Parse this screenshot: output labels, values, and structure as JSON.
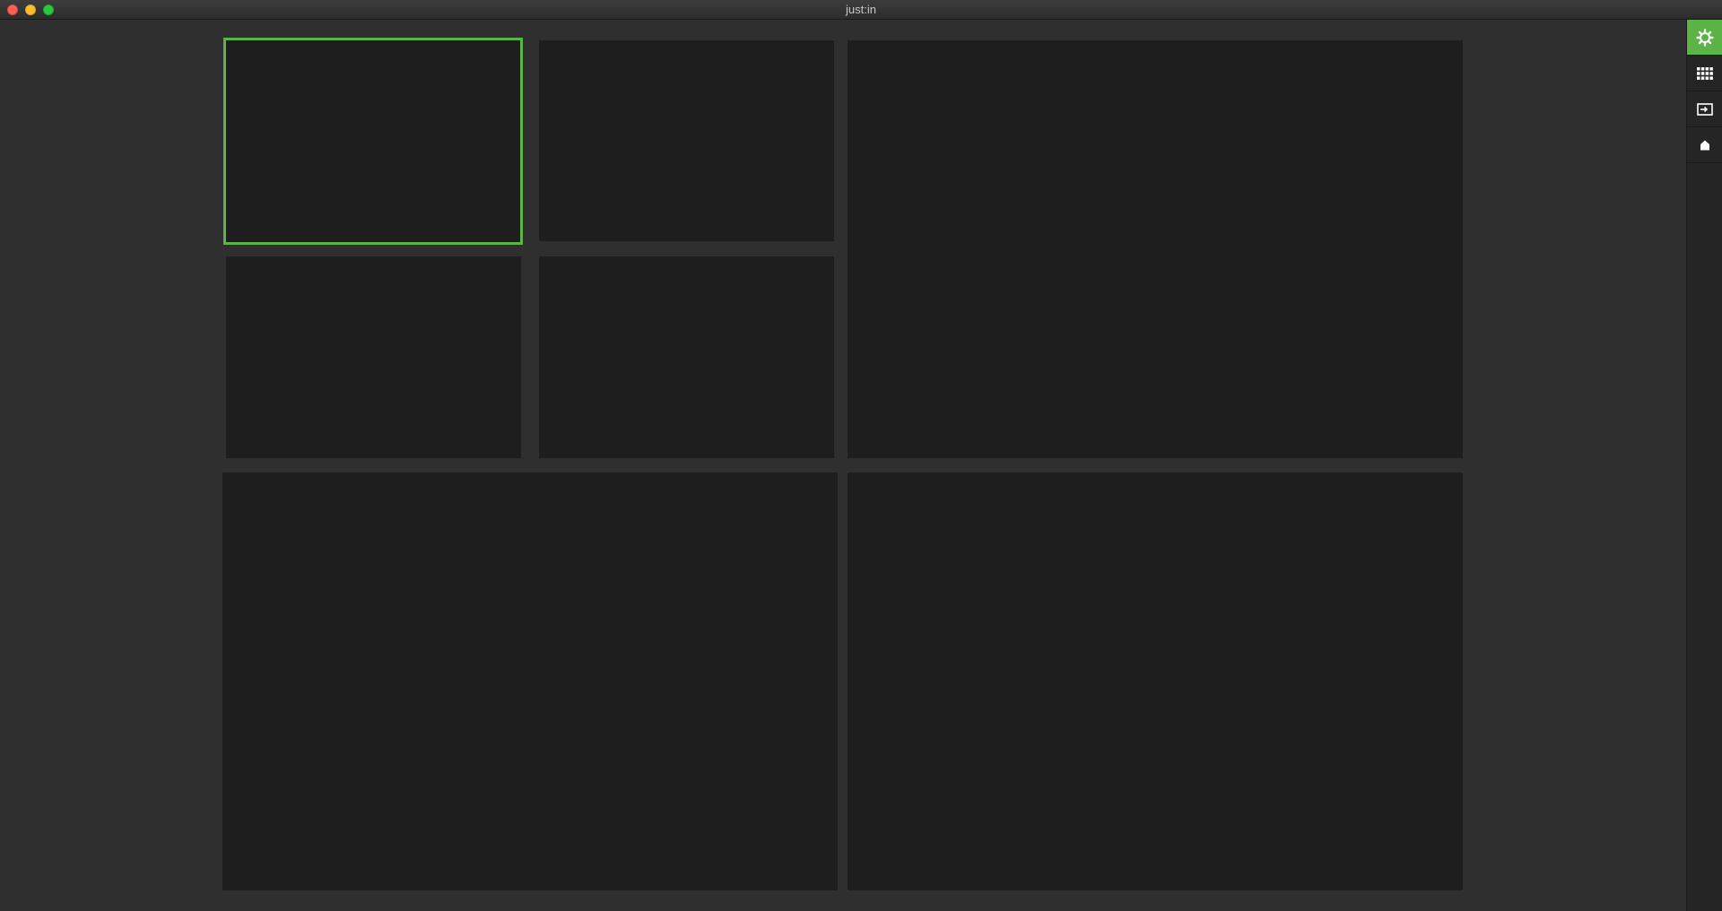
{
  "window": {
    "title": "just:in"
  },
  "colors": {
    "accent": "#5cb346",
    "tile_background": "#1e1e1e",
    "app_background": "#2f2f2f"
  },
  "layout": {
    "tile_count": 7,
    "selected_tile": 1
  },
  "sidebar": {
    "buttons": [
      {
        "icon": "gear-icon",
        "active": true
      },
      {
        "icon": "grid-icon",
        "active": false
      },
      {
        "icon": "input-icon",
        "active": false
      },
      {
        "icon": "house-icon",
        "active": false
      }
    ]
  }
}
